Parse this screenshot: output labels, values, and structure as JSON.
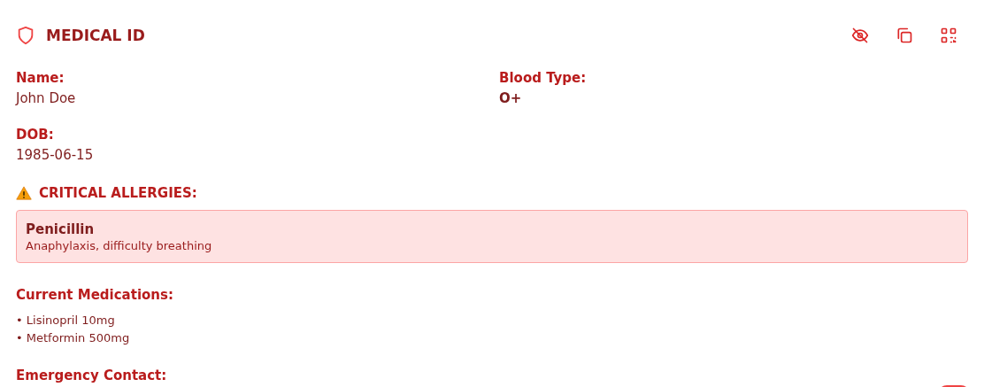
{
  "header": {
    "title": "MEDICAL ID"
  },
  "fields": [
    {
      "label": "Name:",
      "value": "John Doe",
      "emphasis": false
    },
    {
      "label": "Blood Type:",
      "value": "O+",
      "emphasis": true
    },
    {
      "label": "DOB:",
      "value": "1985-06-15",
      "emphasis": false
    }
  ],
  "allergies": {
    "title": "CRITICAL ALLERGIES:",
    "items": [
      {
        "name": "Penicillin",
        "reaction": "Anaphylaxis, difficulty breathing"
      }
    ]
  },
  "medications": {
    "title": "Current Medications:",
    "items": [
      "• Lisinopril 10mg",
      "• Metformin 500mg"
    ]
  },
  "emergency_contact": {
    "title": "Emergency Contact:"
  }
}
